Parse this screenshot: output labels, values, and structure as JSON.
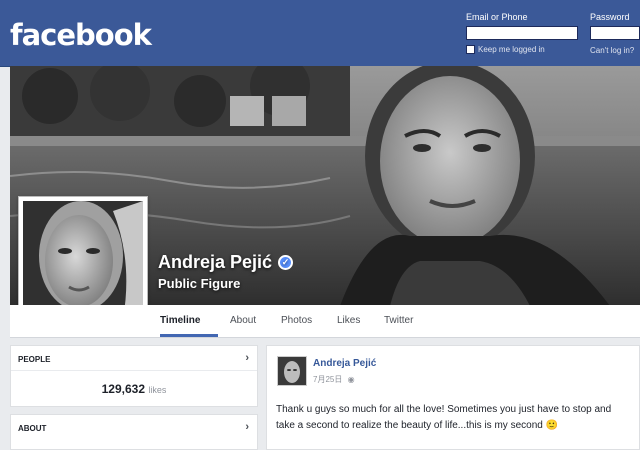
{
  "header": {
    "logo": "facebook",
    "email_label": "Email or Phone",
    "password_label": "Password",
    "keep_logged_in": "Keep me logged in",
    "forgot": "Can't log in?"
  },
  "profile": {
    "name": "Andreja Pejić",
    "category": "Public Figure",
    "verified_icon": "verified-check-icon"
  },
  "tabs": [
    "Timeline",
    "About",
    "Photos",
    "Likes",
    "Twitter"
  ],
  "sidebar": {
    "people_title": "PEOPLE",
    "likes_count": "129,632",
    "likes_unit": "likes",
    "about_title": "ABOUT"
  },
  "post": {
    "author": "Andreja Pejić",
    "time": "7月25日",
    "text": "Thank u guys so much for all the love! Sometimes you just have to stop and take a second to realize the beauty of life...this is my second 🙂"
  },
  "colors": {
    "brand": "#3b5998",
    "link": "#365899",
    "tab_active": "#4267b2"
  }
}
